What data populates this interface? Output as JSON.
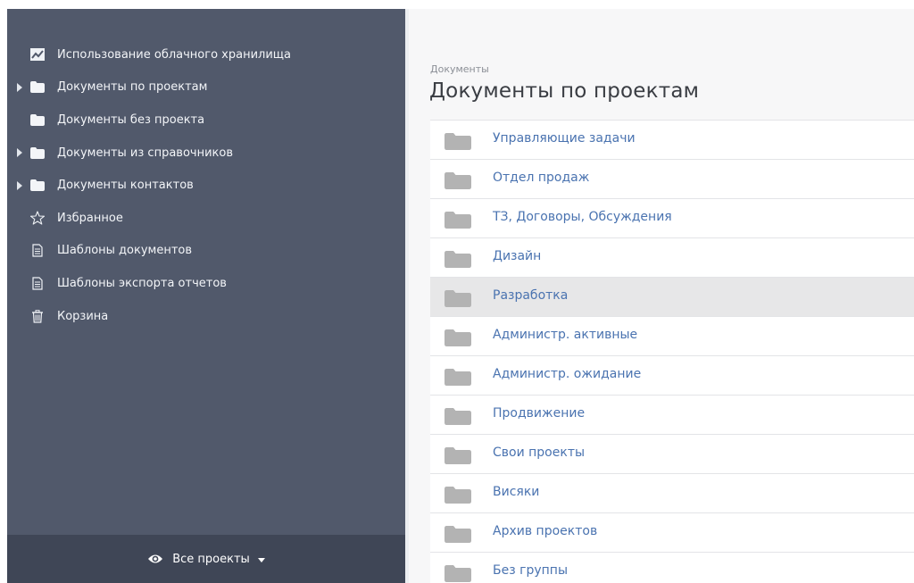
{
  "sidebar": {
    "items": [
      {
        "label": "Использование облачного хранилища",
        "icon": "chart-icon",
        "expandable": false
      },
      {
        "label": "Документы по проектам",
        "icon": "folder-icon",
        "expandable": true
      },
      {
        "label": "Документы без проекта",
        "icon": "folder-icon",
        "expandable": false
      },
      {
        "label": "Документы из справочников",
        "icon": "folder-icon",
        "expandable": true
      },
      {
        "label": "Документы контактов",
        "icon": "folder-icon",
        "expandable": true
      },
      {
        "label": "Избранное",
        "icon": "star-icon",
        "expandable": false
      },
      {
        "label": "Шаблоны документов",
        "icon": "document-icon",
        "expandable": false
      },
      {
        "label": "Шаблоны экспорта отчетов",
        "icon": "document-icon",
        "expandable": false
      },
      {
        "label": "Корзина",
        "icon": "trash-icon",
        "expandable": false
      }
    ],
    "footer": {
      "label": "Все проекты",
      "icon": "eye-icon"
    }
  },
  "main": {
    "breadcrumb": "Документы",
    "title": "Документы по проектам",
    "folders": [
      {
        "name": "Управляющие задачи"
      },
      {
        "name": "Отдел продаж"
      },
      {
        "name": "ТЗ, Договоры, Обсуждения"
      },
      {
        "name": "Дизайн"
      },
      {
        "name": "Разработка",
        "highlighted": true
      },
      {
        "name": "Администр. активные"
      },
      {
        "name": "Администр. ожидание"
      },
      {
        "name": "Продвижение"
      },
      {
        "name": "Свои проекты"
      },
      {
        "name": "Висяки"
      },
      {
        "name": "Архив проектов"
      },
      {
        "name": "Без группы"
      }
    ]
  },
  "colors": {
    "sidebar_bg": "#51596b",
    "sidebar_footer_bg": "#3f4656",
    "link": "#4a73b0",
    "folder_icon": "#b3b3b3",
    "row_highlight": "#e7e7e8"
  }
}
